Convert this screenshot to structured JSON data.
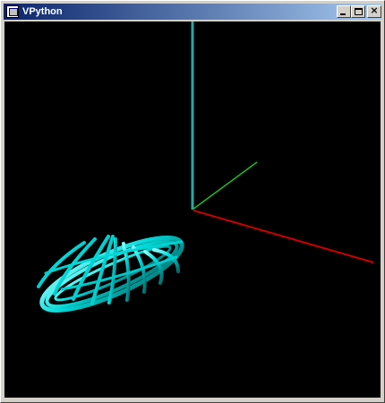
{
  "window": {
    "title": "VPython",
    "icon": "vpython-app-icon",
    "controls": {
      "minimize_icon": "minimize-icon",
      "maximize_icon": "maximize-icon",
      "close_icon": "close-icon",
      "close_glyph": "×"
    }
  },
  "scene": {
    "background": "#000000",
    "axes": {
      "x_color": "#cc0000",
      "y_color": "#2aa7a7",
      "z_color": "#22bb22"
    },
    "object": {
      "name": "cyan-wire-torus",
      "color": "#00d8d8"
    }
  }
}
